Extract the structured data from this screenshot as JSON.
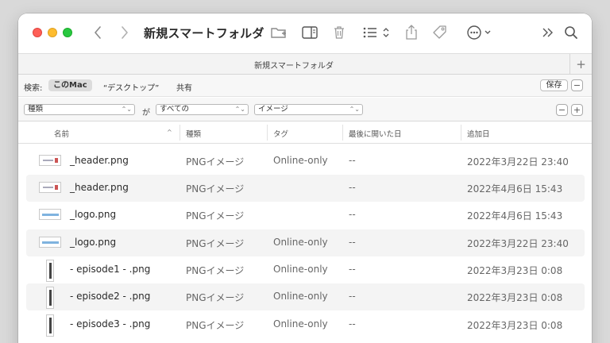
{
  "window": {
    "title": "新規スマートフォルダ"
  },
  "tab": {
    "label": "新規スマートフォルダ",
    "add_label": "+"
  },
  "scope": {
    "search_label": "検索:",
    "options": [
      "このMac",
      "“デスクトップ”",
      "共有"
    ],
    "save_label": "保存",
    "remove_label": "−"
  },
  "criteria": {
    "attribute": "種類",
    "connector": "が",
    "operator": "すべての",
    "value": "イメージ",
    "remove_label": "−",
    "add_label": "+"
  },
  "columns": [
    "名前",
    "種類",
    "タグ",
    "最後に開いた日",
    "追加日"
  ],
  "files": [
    {
      "thumb": "header-thumbnail-icon",
      "name": "_header.png",
      "kind": "PNGイメージ",
      "tag": "Online-only",
      "opened": "--",
      "added": "2022年3月22日 23:40"
    },
    {
      "thumb": "header-thumbnail-icon",
      "name": "_header.png",
      "kind": "PNGイメージ",
      "tag": "",
      "opened": "--",
      "added": "2022年4月6日 15:43"
    },
    {
      "thumb": "logo-thumbnail-icon",
      "name": "_logo.png",
      "kind": "PNGイメージ",
      "tag": "",
      "opened": "--",
      "added": "2022年4月6日 15:43"
    },
    {
      "thumb": "logo-thumbnail-icon",
      "name": "_logo.png",
      "kind": "PNGイメージ",
      "tag": "Online-only",
      "opened": "--",
      "added": "2022年3月22日 23:40"
    },
    {
      "thumb": "episode-thumbnail-icon",
      "name": "- episode1 - .png",
      "kind": "PNGイメージ",
      "tag": "Online-only",
      "opened": "--",
      "added": "2022年3月23日 0:08"
    },
    {
      "thumb": "episode-thumbnail-icon",
      "name": "- episode2 - .png",
      "kind": "PNGイメージ",
      "tag": "Online-only",
      "opened": "--",
      "added": "2022年3月23日 0:08"
    },
    {
      "thumb": "episode-thumbnail-icon",
      "name": "- episode3 - .png",
      "kind": "PNGイメージ",
      "tag": "Online-only",
      "opened": "--",
      "added": "2022年3月23日 0:08"
    }
  ],
  "icons": {
    "back": "chevron-left-icon",
    "forward": "chevron-right-icon",
    "new_folder": "new-folder-icon",
    "preview": "sidebar-panel-icon",
    "trash": "trash-icon",
    "view": "list-view-icon",
    "share": "share-icon",
    "tag": "tag-icon",
    "action": "ellipsis-circle-icon",
    "more": "double-chevron-right-icon",
    "search": "search-icon"
  },
  "colors": {
    "close": "#fe5f57",
    "minimize": "#febc2e",
    "maximize": "#28c840",
    "row_alt": "#f4f4f4"
  }
}
